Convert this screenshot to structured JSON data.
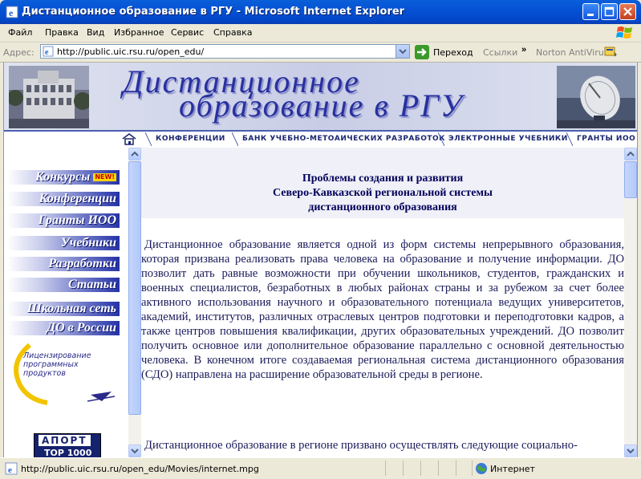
{
  "window": {
    "title": "Дистанционное образование в РГУ - Microsoft Internet Explorer",
    "colors": {
      "titlebar": "#0552d6",
      "close": "#c3401f"
    }
  },
  "menubar": {
    "items": [
      "Файл",
      "Правка",
      "Вид",
      "Избранное",
      "Сервис",
      "Справка"
    ]
  },
  "addressbar": {
    "label": "Адрес:",
    "url": "http://public.uic.rsu.ru/open_edu/",
    "go_label": "Переход",
    "links_label": "Ссылки",
    "chevron": "»",
    "toolbar_label": "Norton AntiVirus"
  },
  "banner": {
    "line1": "Дистанционное",
    "line2": "образование  в РГУ",
    "colors": {
      "text": "#2830a0"
    }
  },
  "topnav": {
    "items": [
      "КОНФЕРЕНЦИИ",
      "БАНК УЧЕБНО-МЕТОАИЧЕСКИХ РАЗРАБОТОК",
      "ЭЛЕКТРОННЫЕ УЧЕБНИКИ",
      "ГРАНТЫ ИОО"
    ]
  },
  "sidebar": {
    "items": [
      {
        "label": "Конкурсы",
        "badge": "NEW!"
      },
      {
        "label": "Конференции"
      },
      {
        "label": "Гранты ИОО"
      },
      {
        "label": "Учебники"
      },
      {
        "label": "Разработки"
      },
      {
        "label": "Статьи"
      },
      {
        "label": "Школьная сеть"
      },
      {
        "label": "ДО в России"
      }
    ],
    "license_text": "Лицензирование программных продуктов",
    "counter": {
      "top": "АПОРТ",
      "bottom": "TOP 1000"
    }
  },
  "content": {
    "heading": [
      "Проблемы создания и развития",
      "Северо-Кавказской региональной системы",
      "дистанционного образования"
    ],
    "paragraph1": "Дистанционное образование является одной из форм системы непрерывного образования, которая призвана реализовать права человека на образование и получение информации. ДО позволит дать равные возможности при обучении школьников, студентов, гражданских и военных специалистов, безработных в любых районах страны и за рубежом за счет более активного использования научного и образовательного потенциала ведущих университетов, академий, институтов, различных отраслевых центров подготовки и переподготовки кадров, а также центров повышения квалификации, других образовательных учреждений. ДО позволит получить основное или дополнительное образование параллельно с основной деятельностью человека. В конечном итоге создаваемая региональная система дистанционного образования (СДО) направлена на расширение образовательной среды в регионе.",
    "paragraph2": "Дистанционное образование в регионе призвано осуществлять следующие социально-"
  },
  "statusbar": {
    "text": "http://public.uic.rsu.ru/open_edu/Movies/internet.mpg",
    "zone": "Интернет"
  }
}
